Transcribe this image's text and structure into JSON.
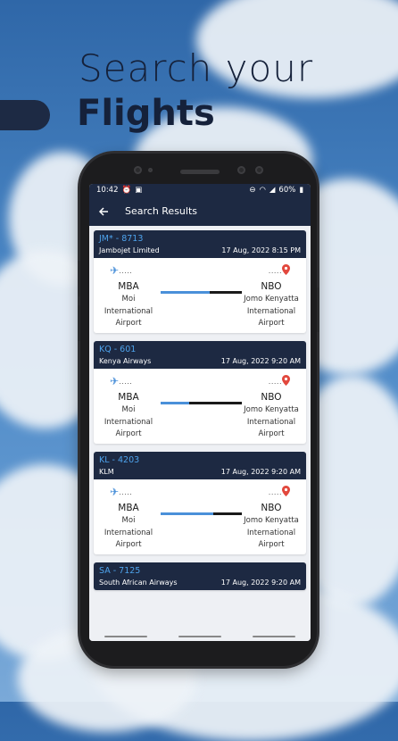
{
  "hero": {
    "line1": "Search your",
    "line2": "Flights"
  },
  "status_bar": {
    "time": "10:42",
    "battery": "60%"
  },
  "app_bar": {
    "title": "Search Results"
  },
  "colors": {
    "navy": "#1d2942",
    "accent_blue": "#4ea3ec",
    "pin_red": "#e2483d"
  },
  "flights": [
    {
      "code": "JM* - 8713",
      "airline": "Jambojet Limited",
      "datetime": "17 Aug, 2022 8:15 PM",
      "from": {
        "code": "MBA",
        "name1": "Moi",
        "name2": "International",
        "name3": "Airport"
      },
      "to": {
        "code": "NBO",
        "name1": "Jomo Kenyatta",
        "name2": "International",
        "name3": "Airport"
      },
      "progress": 0.6
    },
    {
      "code": "KQ - 601",
      "airline": "Kenya Airways",
      "datetime": "17 Aug, 2022 9:20 AM",
      "from": {
        "code": "MBA",
        "name1": "Moi",
        "name2": "International",
        "name3": "Airport"
      },
      "to": {
        "code": "NBO",
        "name1": "Jomo Kenyatta",
        "name2": "International",
        "name3": "Airport"
      },
      "progress": 0.35
    },
    {
      "code": "KL - 4203",
      "airline": "KLM",
      "datetime": "17 Aug, 2022 9:20 AM",
      "from": {
        "code": "MBA",
        "name1": "Moi",
        "name2": "International",
        "name3": "Airport"
      },
      "to": {
        "code": "NBO",
        "name1": "Jomo Kenyatta",
        "name2": "International",
        "name3": "Airport"
      },
      "progress": 0.65
    },
    {
      "code": "SA - 7125",
      "airline": "South African Airways",
      "datetime": "17 Aug, 2022 9:20 AM"
    }
  ]
}
